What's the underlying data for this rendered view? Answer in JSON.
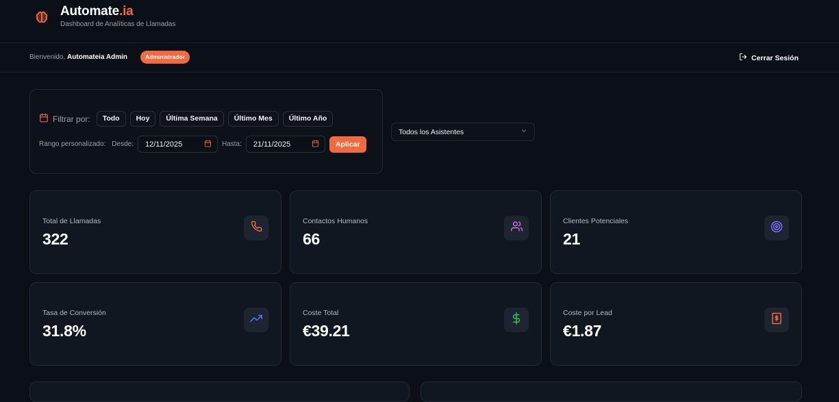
{
  "header": {
    "brand_main": "Automate",
    "brand_accent": ".ia",
    "subtitle": "Dashboard de Analíticas de Llamadas",
    "logo_icon": "brain-icon",
    "accent_color": "#f26a3d"
  },
  "userbar": {
    "welcome_prefix": "Bienvenido,",
    "user_name": "Automateia Admin",
    "role": "Administrador",
    "logout_label": "Cerrar Sesión",
    "logout_icon": "logout-icon"
  },
  "filters": {
    "filter_label": "Filtrar por:",
    "options": [
      "Todo",
      "Hoy",
      "Última Semana",
      "Último Mes",
      "Último Año"
    ],
    "custom_range_label": "Rango personalizado:",
    "from_label": "Desde:",
    "from_value": "12/11/2025",
    "to_label": "Hasta:",
    "to_value": "21/11/2025",
    "apply_label": "Aplicar"
  },
  "assistant_select": {
    "value": "Todos los Asistentes"
  },
  "stats": [
    {
      "label": "Total de Llamadas",
      "value": "322",
      "icon": "phone-icon",
      "color": "#f26a3d"
    },
    {
      "label": "Contactos Humanos",
      "value": "66",
      "icon": "users-icon",
      "color": "#c678dd"
    },
    {
      "label": "Clientes Potenciales",
      "value": "21",
      "icon": "target-icon",
      "color": "#7b6cf6"
    },
    {
      "label": "Tasa de Conversión",
      "value": "31.8%",
      "icon": "trending-up-icon",
      "color": "#3b82f6"
    },
    {
      "label": "Coste Total",
      "value": "€39.21",
      "icon": "dollar-icon",
      "color": "#22c55e"
    },
    {
      "label": "Coste por Lead",
      "value": "€1.87",
      "icon": "receipt-icon",
      "color": "#f26a3d"
    }
  ]
}
